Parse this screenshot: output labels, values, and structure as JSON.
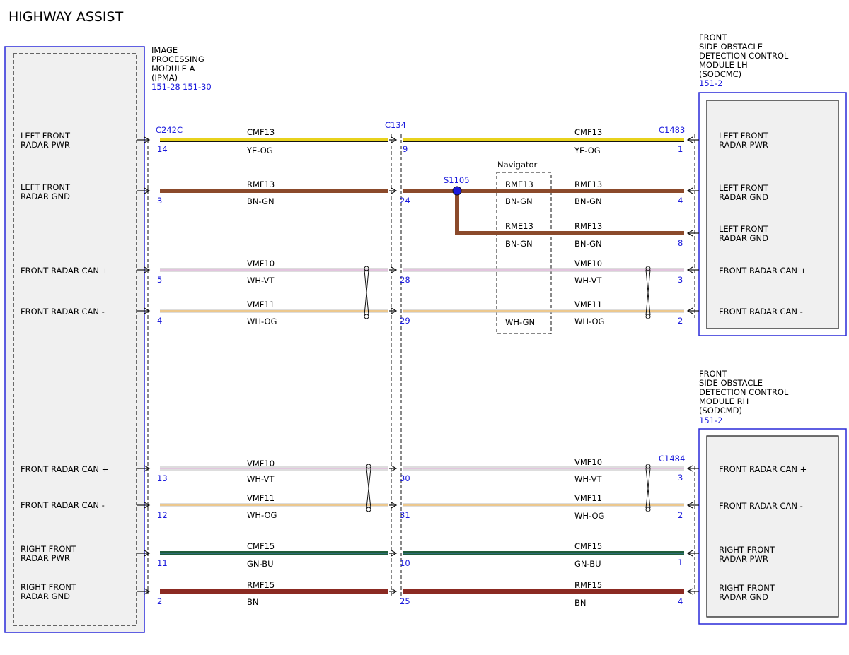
{
  "title": "HIGHWAY ASSIST",
  "modules": {
    "ipma": {
      "lines": [
        "IMAGE",
        "PROCESSING",
        "MODULE A",
        "(IPMA)"
      ],
      "refs": [
        "151-28",
        "151-30"
      ],
      "pins_labels": [
        [
          "LEFT FRONT",
          "RADAR PWR"
        ],
        [
          "LEFT FRONT",
          "RADAR GND"
        ],
        [
          "FRONT RADAR CAN +"
        ],
        [
          "FRONT RADAR CAN -"
        ],
        [
          "FRONT RADAR CAN +"
        ],
        [
          "FRONT RADAR CAN -"
        ],
        [
          "RIGHT FRONT",
          "RADAR PWR"
        ],
        [
          "RIGHT FRONT",
          "RADAR GND"
        ]
      ]
    },
    "sodcmc": {
      "lines": [
        "FRONT",
        "SIDE OBSTACLE",
        "DETECTION CONTROL",
        "MODULE LH",
        "(SODCMC)"
      ],
      "ref": "151-2",
      "pins_labels": [
        [
          "LEFT FRONT",
          "RADAR PWR"
        ],
        [
          "LEFT FRONT",
          "RADAR GND"
        ],
        [
          "LEFT FRONT",
          "RADAR GND"
        ],
        [
          "FRONT RADAR CAN +"
        ],
        [
          "FRONT RADAR CAN -"
        ]
      ]
    },
    "sodcmd": {
      "lines": [
        "FRONT",
        "SIDE OBSTACLE",
        "DETECTION CONTROL",
        "MODULE RH",
        "(SODCMD)"
      ],
      "ref": "151-2",
      "pins_labels": [
        [
          "FRONT RADAR CAN +"
        ],
        [
          "FRONT RADAR CAN -"
        ],
        [
          "RIGHT FRONT",
          "RADAR PWR"
        ],
        [
          "RIGHT FRONT",
          "RADAR GND"
        ]
      ]
    }
  },
  "connectors": {
    "c242c": "C242C",
    "c134": "C134",
    "c1483": "C1483",
    "c1484": "C1484"
  },
  "splice": "S1105",
  "navigator": {
    "label": "Navigator",
    "circuits": [
      "RME13",
      "RME13"
    ],
    "colors": [
      "BN-GN",
      "BN-GN",
      "WH-GN"
    ]
  },
  "wires": [
    {
      "circuit": "CMF13",
      "color_code": "YE-OG",
      "pins": [
        "14",
        "9",
        "1"
      ],
      "hex": "#e8d21c"
    },
    {
      "circuit": "RMF13",
      "color_code": "BN-GN",
      "pins": [
        "3",
        "24",
        "4"
      ],
      "hex": "#8b4a2b"
    },
    {
      "circuit": "RMF13",
      "color_code": "BN-GN",
      "pins": [
        "8"
      ],
      "hex": "#8b4a2b"
    },
    {
      "circuit": "VMF10",
      "color_code": "WH-VT",
      "pins": [
        "5",
        "28",
        "3"
      ],
      "hex": "#d9a6c9"
    },
    {
      "circuit": "VMF11",
      "color_code": "WH-OG",
      "pins": [
        "4",
        "29",
        "2"
      ],
      "hex": "#e7c27a"
    },
    {
      "circuit": "VMF10",
      "color_code": "WH-VT",
      "pins": [
        "13",
        "30",
        "3"
      ],
      "hex": "#d9a6c9"
    },
    {
      "circuit": "VMF11",
      "color_code": "WH-OG",
      "pins": [
        "12",
        "31",
        "2"
      ],
      "hex": "#e7c27a"
    },
    {
      "circuit": "CMF15",
      "color_code": "GN-BU",
      "pins": [
        "11",
        "10",
        "1"
      ],
      "hex": "#1f5e3a"
    },
    {
      "circuit": "RMF15",
      "color_code": "BN",
      "pins": [
        "2",
        "25",
        "4"
      ],
      "hex": "#8b2a22"
    }
  ],
  "colors": {
    "module_border": "#2a2ad8",
    "pin_text": "#1a1adc",
    "module_fill": "#f0f0f0"
  }
}
